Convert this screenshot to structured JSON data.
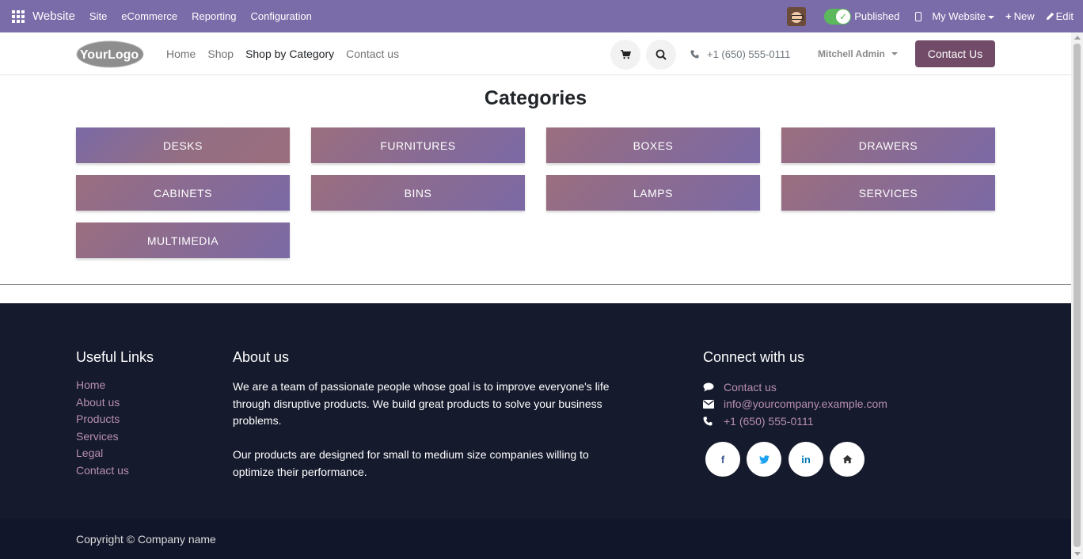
{
  "admin_bar": {
    "brand": "Website",
    "menu": [
      "Site",
      "eCommerce",
      "Reporting",
      "Configuration"
    ],
    "published_label": "Published",
    "website_label": "My Website",
    "new_label": "New",
    "edit_label": "Edit"
  },
  "header": {
    "logo_text": "YourLogo",
    "nav": [
      "Home",
      "Shop",
      "Shop by Category",
      "Contact us"
    ],
    "active_nav": "Shop by Category",
    "phone": "+1 (650) 555-0111",
    "user": "Mitchell Admin",
    "contact_button": "Contact Us"
  },
  "categories": {
    "title": "Categories",
    "items": [
      "DESKS",
      "FURNITURES",
      "BOXES",
      "DRAWERS",
      "CABINETS",
      "BINS",
      "LAMPS",
      "SERVICES",
      "MULTIMEDIA"
    ]
  },
  "footer": {
    "useful_links_title": "Useful Links",
    "useful_links": [
      "Home",
      "About us",
      "Products",
      "Services",
      "Legal",
      "Contact us"
    ],
    "about_title": "About us",
    "about_p1": "We are a team of passionate people whose goal is to improve everyone's life through disruptive products. We build great products to solve your business problems.",
    "about_p2": "Our products are designed for small to medium size companies willing to optimize their performance.",
    "connect_title": "Connect with us",
    "connect_contact": "Contact us",
    "connect_email": "info@yourcompany.example.com",
    "connect_phone": "+1 (650) 555-0111",
    "social": [
      {
        "name": "facebook-icon",
        "glyph": "f",
        "color": "#3b5998"
      },
      {
        "name": "twitter-icon",
        "glyph": "🐦",
        "color": "#1da1f2"
      },
      {
        "name": "linkedin-icon",
        "glyph": "in",
        "color": "#0077b5"
      },
      {
        "name": "home-icon",
        "glyph": "⌂",
        "color": "#333333"
      }
    ],
    "copyright": "Copyright © Company name"
  },
  "colors": {
    "admin_bar": "#7a6ca8",
    "primary_button": "#714b67",
    "footer_bg": "#151a2d",
    "link": "#b88fad"
  }
}
